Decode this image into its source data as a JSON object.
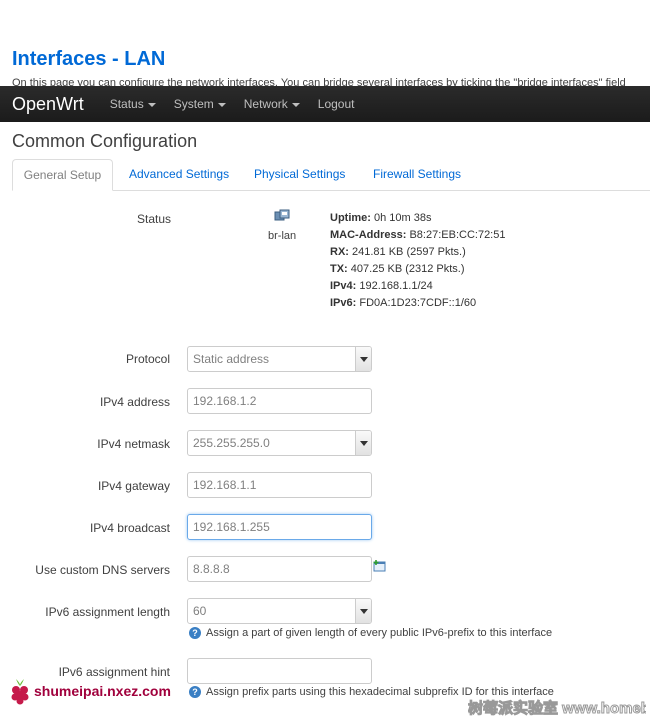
{
  "page": {
    "title": "Interfaces - LAN",
    "description": "On this page you can configure the network interfaces. You can bridge several interfaces by ticking the \"bridge interfaces\" field"
  },
  "navbar": {
    "brand": "OpenWrt",
    "items": [
      {
        "label": "Status",
        "dropdown": true
      },
      {
        "label": "System",
        "dropdown": true
      },
      {
        "label": "Network",
        "dropdown": true
      },
      {
        "label": "Logout",
        "dropdown": false
      }
    ],
    "bg_color": "#222222"
  },
  "section": {
    "title": "Common Configuration",
    "tabs": [
      {
        "label": "General Setup",
        "active": true
      },
      {
        "label": "Advanced Settings",
        "active": false
      },
      {
        "label": "Physical Settings",
        "active": false
      },
      {
        "label": "Firewall Settings",
        "active": false
      }
    ]
  },
  "status": {
    "label": "Status",
    "device_icon": "ethernet-port-icon",
    "device_name": "br-lan",
    "uptime_key": "Uptime:",
    "uptime": "0h 10m 38s",
    "mac_key": "MAC-Address:",
    "mac": "B8:27:EB:CC:72:51",
    "rx_key": "RX:",
    "rx": "241.81 KB (2597 Pkts.)",
    "tx_key": "TX:",
    "tx": "407.25 KB (2312 Pkts.)",
    "ipv4_key": "IPv4:",
    "ipv4": "192.168.1.1/24",
    "ipv6_key": "IPv6:",
    "ipv6": "FD0A:1D23:7CDF::1/60"
  },
  "form": {
    "protocol": {
      "label": "Protocol",
      "value": "Static address"
    },
    "ipv4_address": {
      "label": "IPv4 address",
      "value": "192.168.1.2"
    },
    "ipv4_netmask": {
      "label": "IPv4 netmask",
      "value": "255.255.255.0"
    },
    "ipv4_gateway": {
      "label": "IPv4 gateway",
      "value": "192.168.1.1"
    },
    "ipv4_broadcast": {
      "label": "IPv4 broadcast",
      "value": "192.168.1.255"
    },
    "dns": {
      "label": "Use custom DNS servers",
      "value": "8.8.8.8",
      "add_icon": "add-entry-icon"
    },
    "ipv6_length": {
      "label": "IPv6 assignment length",
      "value": "60",
      "help": "Assign a part of given length of every public IPv6-prefix to this interface"
    },
    "ipv6_hint": {
      "label": "IPv6 assignment hint",
      "value": "",
      "help": "Assign prefix parts using this hexadecimal subprefix ID for this interface"
    }
  },
  "watermark": {
    "left": "shumeipai.nxez.com",
    "right": "树莓派实验室 www.homebaike.com"
  },
  "colors": {
    "link": "#0069d6",
    "title": "#0069d6",
    "focus": "#6aa9e9",
    "watermark": "#a0003c"
  }
}
